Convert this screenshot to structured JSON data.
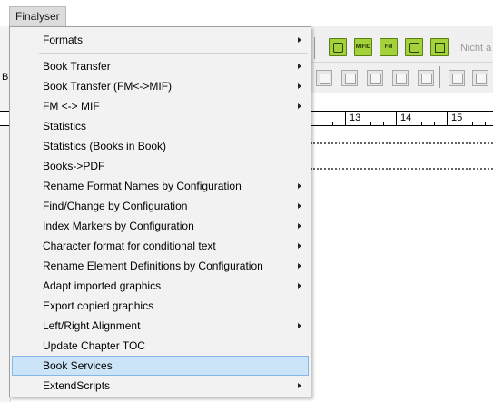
{
  "menubar": {
    "active_menu": "Finalyser"
  },
  "toolbar": {
    "green_buttons": [
      {
        "icon": "toggle-frame-icon",
        "text": ""
      },
      {
        "icon": "mif-icon",
        "text": "MIFID"
      },
      {
        "icon": "fm-icon",
        "text": "FM"
      },
      {
        "icon": "refresh-link-icon",
        "text": ""
      },
      {
        "icon": "columns-icon",
        "text": ""
      }
    ],
    "status_text": "Nicht a",
    "accent_color": "#a4d23a"
  },
  "ruler": {
    "marks": [
      "13",
      "14",
      "15"
    ]
  },
  "left_strip": {
    "row_initial": "B"
  },
  "menu": {
    "items": [
      {
        "label": "Formats",
        "submenu": true
      },
      {
        "label": "Book Transfer",
        "submenu": true
      },
      {
        "label": "Book Transfer (FM<->MIF)",
        "submenu": true
      },
      {
        "label": "FM <-> MIF",
        "submenu": true
      },
      {
        "label": "Statistics",
        "submenu": false
      },
      {
        "label": "Statistics (Books in Book)",
        "submenu": false
      },
      {
        "label": "Books->PDF",
        "submenu": false
      },
      {
        "label": "Rename Format Names by Configuration",
        "submenu": true
      },
      {
        "label": "Find/Change by Configuration",
        "submenu": true
      },
      {
        "label": "Index Markers by Configuration",
        "submenu": true
      },
      {
        "label": "Character format for conditional text",
        "submenu": true
      },
      {
        "label": "Rename Element Definitions by Configuration",
        "submenu": true
      },
      {
        "label": "Adapt imported graphics",
        "submenu": true
      },
      {
        "label": "Export copied graphics",
        "submenu": false
      },
      {
        "label": "Left/Right Alignment",
        "submenu": true
      },
      {
        "label": "Update Chapter TOC",
        "submenu": false
      },
      {
        "label": "Book Services",
        "submenu": false,
        "highlighted": true
      },
      {
        "label": "ExtendScripts",
        "submenu": true
      }
    ],
    "highlight_color": "#cce4f7"
  }
}
